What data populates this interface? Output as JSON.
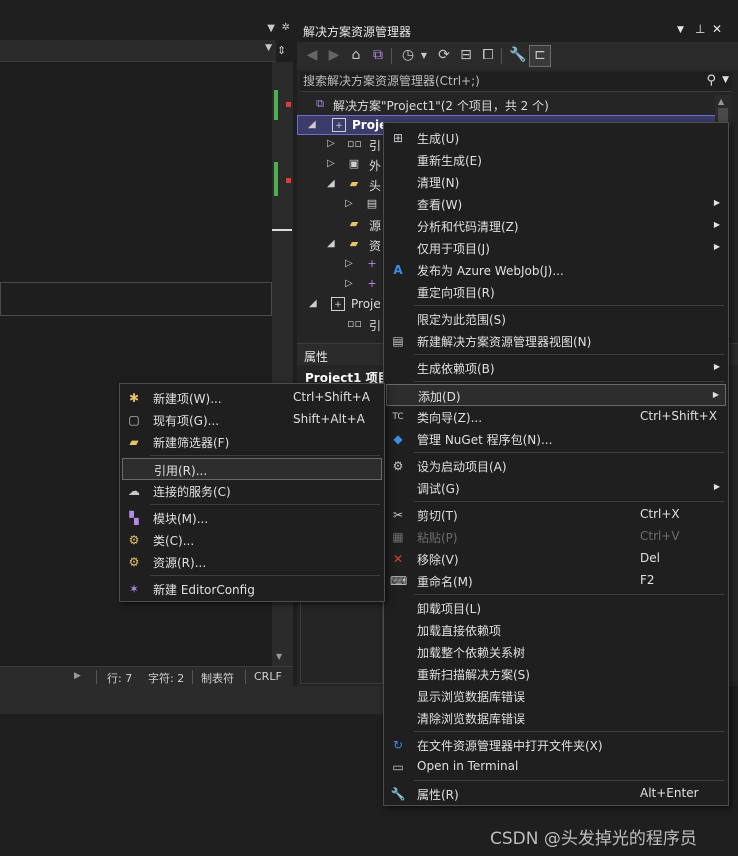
{
  "solution_explorer": {
    "title": "解决方案资源管理器",
    "search_placeholder": "搜索解决方案资源管理器(Ctrl+;)",
    "tree": [
      {
        "label": "解决方案\"Project1\"(2 个项目，共 2 个)"
      },
      {
        "label": "Proje"
      },
      {
        "label": "引"
      },
      {
        "label": "外"
      },
      {
        "label": "头"
      },
      {
        "label": ""
      },
      {
        "label": "源"
      },
      {
        "label": "资"
      },
      {
        "label": ""
      },
      {
        "label": ""
      },
      {
        "label": "Proje"
      },
      {
        "label": "引"
      }
    ]
  },
  "properties": {
    "title": "属性",
    "subject": "Project1 项目"
  },
  "status_bar": {
    "line": "行: 7",
    "char": "字符: 2",
    "tabs": "制表符",
    "eol": "CRLF"
  },
  "context_menu": {
    "items": [
      {
        "label": "生成(U)",
        "shortcut": ""
      },
      {
        "label": "重新生成(E)",
        "shortcut": ""
      },
      {
        "label": "清理(N)",
        "shortcut": ""
      },
      {
        "label": "查看(W)",
        "shortcut": ""
      },
      {
        "label": "分析和代码清理(Z)",
        "shortcut": ""
      },
      {
        "label": "仅用于项目(J)",
        "shortcut": ""
      },
      {
        "label": "发布为 Azure WebJob(J)...",
        "shortcut": ""
      },
      {
        "label": "重定向项目(R)",
        "shortcut": ""
      },
      {
        "label": "限定为此范围(S)",
        "shortcut": ""
      },
      {
        "label": "新建解决方案资源管理器视图(N)",
        "shortcut": ""
      },
      {
        "label": "生成依赖项(B)",
        "shortcut": ""
      },
      {
        "label": "添加(D)",
        "shortcut": ""
      },
      {
        "label": "类向导(Z)...",
        "shortcut": "Ctrl+Shift+X"
      },
      {
        "label": "管理 NuGet 程序包(N)...",
        "shortcut": ""
      },
      {
        "label": "设为启动项目(A)",
        "shortcut": ""
      },
      {
        "label": "调试(G)",
        "shortcut": ""
      },
      {
        "label": "剪切(T)",
        "shortcut": "Ctrl+X"
      },
      {
        "label": "粘贴(P)",
        "shortcut": "Ctrl+V"
      },
      {
        "label": "移除(V)",
        "shortcut": "Del"
      },
      {
        "label": "重命名(M)",
        "shortcut": "F2"
      },
      {
        "label": "卸载项目(L)",
        "shortcut": ""
      },
      {
        "label": "加载直接依赖项",
        "shortcut": ""
      },
      {
        "label": "加载整个依赖关系树",
        "shortcut": ""
      },
      {
        "label": "重新扫描解决方案(S)",
        "shortcut": ""
      },
      {
        "label": "显示浏览数据库错误",
        "shortcut": ""
      },
      {
        "label": "清除浏览数据库错误",
        "shortcut": ""
      },
      {
        "label": "在文件资源管理器中打开文件夹(X)",
        "shortcut": ""
      },
      {
        "label": "Open in Terminal",
        "shortcut": ""
      },
      {
        "label": "属性(R)",
        "shortcut": "Alt+Enter"
      }
    ]
  },
  "add_submenu": {
    "items": [
      {
        "label": "新建项(W)...",
        "shortcut": "Ctrl+Shift+A"
      },
      {
        "label": "现有项(G)...",
        "shortcut": "Shift+Alt+A"
      },
      {
        "label": "新建筛选器(F)",
        "shortcut": ""
      },
      {
        "label": "引用(R)...",
        "shortcut": ""
      },
      {
        "label": "连接的服务(C)",
        "shortcut": ""
      },
      {
        "label": "模块(M)...",
        "shortcut": ""
      },
      {
        "label": "类(C)...",
        "shortcut": ""
      },
      {
        "label": "资源(R)...",
        "shortcut": ""
      },
      {
        "label": "新建 EditorConfig",
        "shortcut": ""
      }
    ]
  },
  "watermark": "CSDN @头发掉光的程序员",
  "colors": {
    "background": "#1f1f1f",
    "panel": "#252526",
    "selection": "#3c3c6c",
    "accent_blue": "#3a8ee6",
    "error_red": "#e03a3a",
    "ok_green": "#4caf50"
  }
}
